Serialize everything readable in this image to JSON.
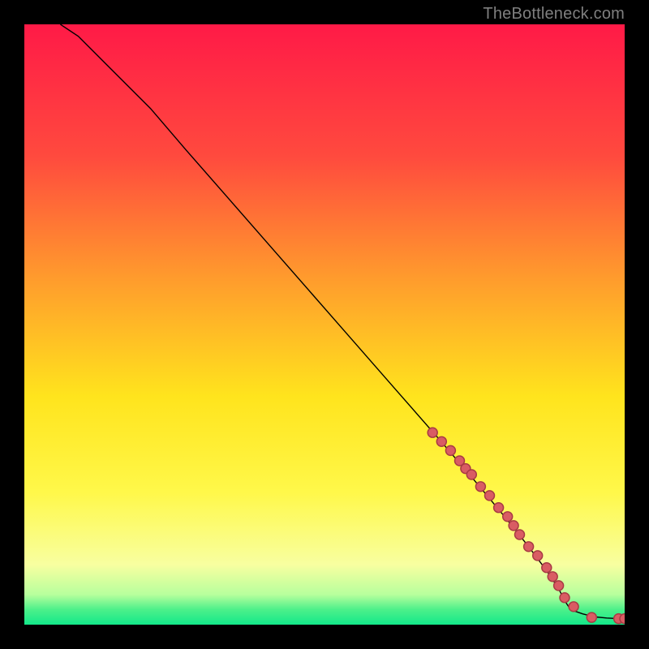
{
  "attribution": "TheBottleneck.com",
  "colors": {
    "frame": "#000000",
    "attribution_text": "#7f7f7f",
    "curve_stroke": "#000000",
    "marker_fill": "#d95c63",
    "marker_stroke": "#a83a44",
    "gradient_stops": [
      {
        "offset": 0.0,
        "color": "#ff1a47"
      },
      {
        "offset": 0.22,
        "color": "#ff4a3e"
      },
      {
        "offset": 0.42,
        "color": "#ff9a2d"
      },
      {
        "offset": 0.62,
        "color": "#ffe41d"
      },
      {
        "offset": 0.78,
        "color": "#fff84a"
      },
      {
        "offset": 0.9,
        "color": "#f8ffa0"
      },
      {
        "offset": 0.95,
        "color": "#b7ff9d"
      },
      {
        "offset": 0.975,
        "color": "#4cf08a"
      },
      {
        "offset": 1.0,
        "color": "#13e88a"
      }
    ]
  },
  "chart_data": {
    "type": "line",
    "title": "",
    "xlabel": "",
    "ylabel": "",
    "xlim": [
      0,
      100
    ],
    "ylim": [
      0,
      100
    ],
    "grid": false,
    "legend": false,
    "series": [
      {
        "name": "curve",
        "x": [
          6,
          9,
          12,
          16,
          21,
          27,
          34,
          41,
          48,
          55,
          62,
          69,
          75,
          80,
          84,
          87,
          89,
          90,
          91,
          93,
          95,
          97,
          99,
          100
        ],
        "y": [
          100,
          98,
          95,
          91,
          86,
          79,
          71,
          63,
          55,
          47,
          39,
          31,
          24,
          18,
          13,
          9,
          6,
          4,
          2.5,
          1.8,
          1.3,
          1.1,
          1.0,
          1.0
        ]
      }
    ],
    "markers": {
      "name": "highlight-points",
      "x": [
        68,
        69.5,
        71,
        72.5,
        73.5,
        74.5,
        76,
        77.5,
        79,
        80.5,
        81.5,
        82.5,
        84,
        85.5,
        87,
        88,
        89,
        90,
        91.5,
        94.5,
        99,
        100
      ],
      "y": [
        32,
        30.5,
        29,
        27.3,
        26,
        25,
        23,
        21.5,
        19.5,
        18,
        16.5,
        15,
        13,
        11.5,
        9.5,
        8,
        6.5,
        4.5,
        3,
        1.2,
        1.0,
        1.0
      ]
    },
    "marker_radius_px": 6
  }
}
